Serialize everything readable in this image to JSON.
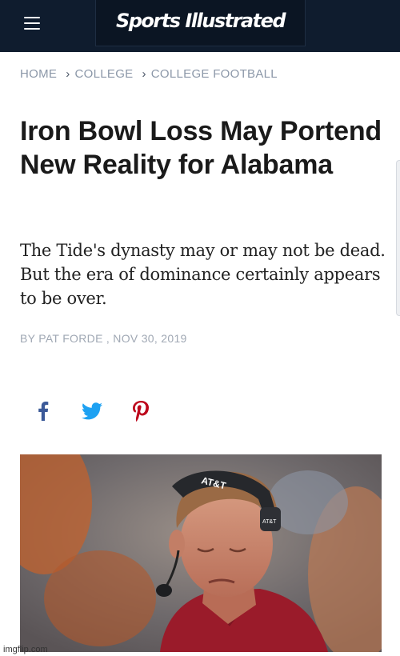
{
  "header": {
    "brand": "Sports Illustrated",
    "menu_icon": "hamburger-menu-icon",
    "background": "#0f1c2e"
  },
  "breadcrumb": {
    "items": [
      "HOME",
      "COLLEGE",
      "COLLEGE FOOTBALL"
    ],
    "separator_icon": "chevron-right-icon"
  },
  "article": {
    "headline": "Iron Bowl Loss May Portend New Reality for Alabama",
    "dek": "The Tide's dynasty may or may not be dead. But the era of dominance certainly appears to be over.",
    "byline_prefix": "BY ",
    "author": "PAT FORDE",
    "date_sep": " , ",
    "date": "NOV 30, 2019"
  },
  "share": [
    {
      "network": "facebook",
      "icon": "facebook-icon",
      "color": "#3b5998"
    },
    {
      "network": "twitter",
      "icon": "twitter-icon",
      "color": "#1da1f2"
    },
    {
      "network": "pinterest",
      "icon": "pinterest-icon",
      "color": "#bd081c"
    }
  ],
  "hero": {
    "headset_text": "AT&T",
    "headset_small_text": "AT&T"
  },
  "watermark": "imgflip.com"
}
